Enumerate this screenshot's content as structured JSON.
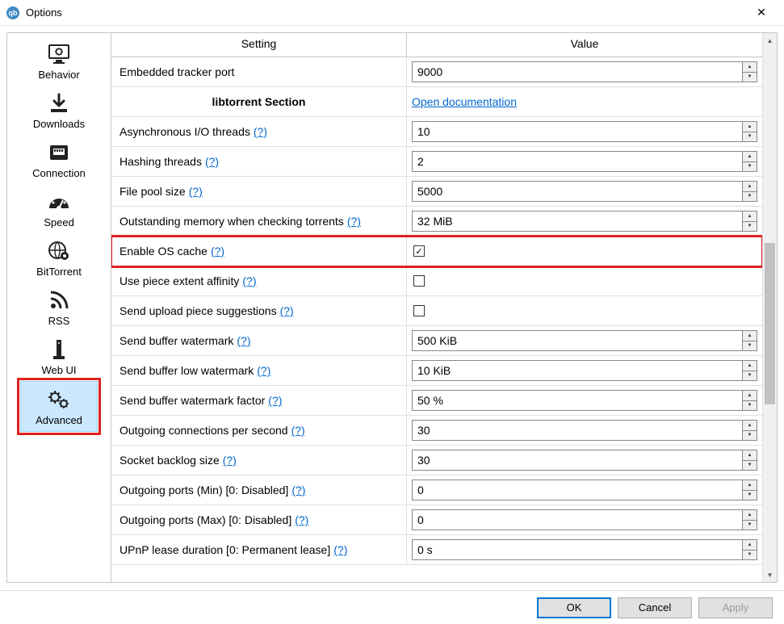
{
  "window": {
    "title": "Options"
  },
  "sidebar": {
    "items": [
      {
        "label": "Behavior",
        "selected": false
      },
      {
        "label": "Downloads",
        "selected": false
      },
      {
        "label": "Connection",
        "selected": false
      },
      {
        "label": "Speed",
        "selected": false
      },
      {
        "label": "BitTorrent",
        "selected": false
      },
      {
        "label": "RSS",
        "selected": false
      },
      {
        "label": "Web UI",
        "selected": false
      },
      {
        "label": "Advanced",
        "selected": true
      }
    ]
  },
  "table": {
    "headers": {
      "setting": "Setting",
      "value": "Value"
    },
    "section_title": "libtorrent Section",
    "doc_link": "Open documentation",
    "help_marker": "(?)",
    "rows": {
      "tracker_port": {
        "label": "Embedded tracker port",
        "value": "9000"
      },
      "async_io": {
        "label": "Asynchronous I/O threads",
        "value": "10"
      },
      "hash_threads": {
        "label": "Hashing threads",
        "value": "2"
      },
      "file_pool": {
        "label": "File pool size",
        "value": "5000"
      },
      "outstanding_mem": {
        "label": "Outstanding memory when checking torrents",
        "value": "32 MiB"
      },
      "os_cache": {
        "label": "Enable OS cache",
        "checked": true
      },
      "piece_affinity": {
        "label": "Use piece extent affinity",
        "checked": false
      },
      "upload_sugg": {
        "label": "Send upload piece suggestions",
        "checked": false
      },
      "sbw": {
        "label": "Send buffer watermark",
        "value": "500 KiB"
      },
      "sbw_low": {
        "label": "Send buffer low watermark",
        "value": "10 KiB"
      },
      "sbw_factor": {
        "label": "Send buffer watermark factor",
        "value": "50 %"
      },
      "out_conn": {
        "label": "Outgoing connections per second",
        "value": "30"
      },
      "backlog": {
        "label": "Socket backlog size",
        "value": "30"
      },
      "out_min": {
        "label": "Outgoing ports (Min) [0: Disabled]",
        "value": "0"
      },
      "out_max": {
        "label": "Outgoing ports (Max) [0: Disabled]",
        "value": "0"
      },
      "upnp": {
        "label": "UPnP lease duration [0: Permanent lease]",
        "value": "0 s"
      }
    }
  },
  "buttons": {
    "ok": "OK",
    "cancel": "Cancel",
    "apply": "Apply"
  }
}
